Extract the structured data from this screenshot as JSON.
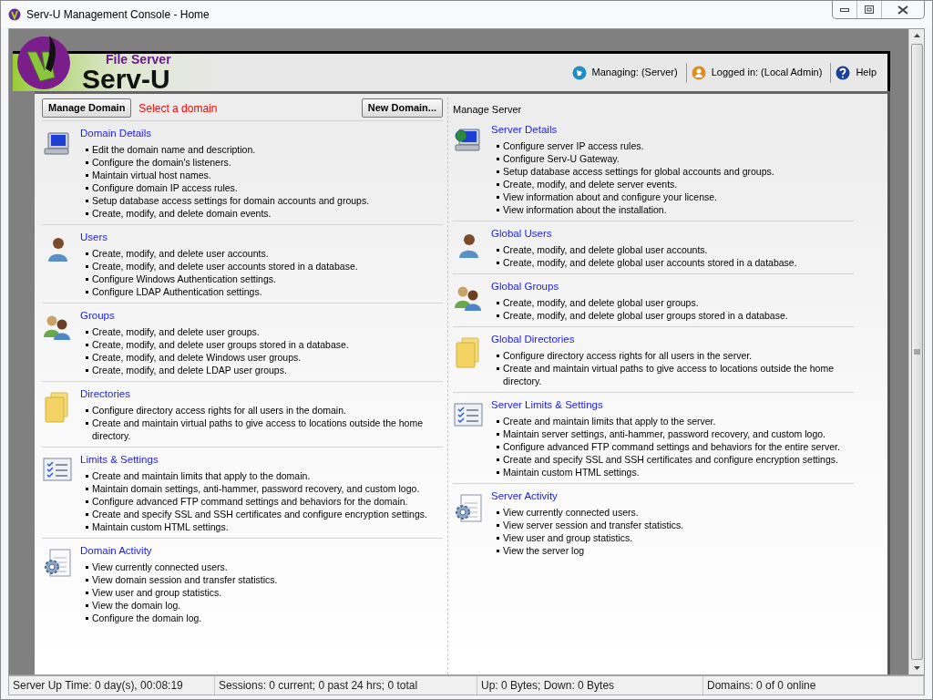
{
  "window": {
    "title": "Serv-U Management Console - Home"
  },
  "logo": {
    "subtitle": "File Server",
    "name": "Serv-U"
  },
  "header_links": [
    {
      "kind": "managing",
      "label": "Managing: (Server)"
    },
    {
      "kind": "user",
      "label": "Logged in: (Local Admin)"
    },
    {
      "kind": "help",
      "label": "Help"
    }
  ],
  "domain_toolbar": {
    "manage_button": "Manage Domain",
    "message": "Select a domain",
    "new_button": "New Domain..."
  },
  "domain_sections": [
    {
      "kind": "monitor",
      "title": "Domain Details",
      "items": [
        "Edit the domain name and description.",
        "Configure the domain's listeners.",
        "Maintain virtual host names.",
        "Configure domain IP access rules.",
        "Setup database access settings for domain accounts and groups.",
        "Create, modify, and delete domain events."
      ]
    },
    {
      "kind": "user",
      "title": "Users",
      "items": [
        "Create, modify, and delete user accounts.",
        "Create, modify, and delete user accounts stored in a database.",
        "Configure Windows Authentication settings.",
        "Configure LDAP Authentication settings."
      ]
    },
    {
      "kind": "group",
      "title": "Groups",
      "items": [
        "Create, modify, and delete user groups.",
        "Create, modify, and delete user groups stored in a database.",
        "Create, modify, and delete Windows user groups.",
        "Create, modify, and delete LDAP user groups."
      ]
    },
    {
      "kind": "folder",
      "title": "Directories",
      "items": [
        "Configure directory access rights for all users in the domain.",
        "Create and maintain virtual paths to give access to locations outside the home directory."
      ]
    },
    {
      "kind": "checklist",
      "title": "Limits & Settings",
      "items": [
        "Create and maintain limits that apply to the domain.",
        "Maintain domain settings, anti-hammer, password recovery, and custom logo.",
        "Configure advanced FTP command settings and behaviors for the domain.",
        "Create and specify SSL and SSH certificates and configure encryption settings.",
        "Maintain custom HTML settings."
      ]
    },
    {
      "kind": "gear",
      "title": "Domain Activity",
      "items": [
        "View currently connected users.",
        "View domain session and transfer statistics.",
        "View user and group statistics.",
        "View the domain log.",
        "Configure the domain log."
      ]
    }
  ],
  "server_heading": "Manage Server",
  "server_sections": [
    {
      "kind": "server",
      "title": "Server Details",
      "items": [
        "Configure server IP access rules.",
        "Configure Serv-U Gateway.",
        "Setup database access settings for global accounts and groups.",
        "Create, modify, and delete server events.",
        "View information about and configure your license.",
        "View information about the installation."
      ]
    },
    {
      "kind": "user",
      "title": "Global Users",
      "items": [
        "Create, modify, and delete global user accounts.",
        "Create, modify, and delete global user accounts stored in a database."
      ]
    },
    {
      "kind": "group",
      "title": "Global Groups",
      "items": [
        "Create, modify, and delete global user groups.",
        "Create, modify, and delete global user groups stored in a database."
      ]
    },
    {
      "kind": "folder",
      "title": "Global Directories",
      "items": [
        "Configure directory access rights for all users in the server.",
        "Create and maintain virtual paths to give access to locations outside the home directory."
      ]
    },
    {
      "kind": "checklist",
      "title": "Server Limits & Settings",
      "items": [
        "Create and maintain limits that apply to the server.",
        "Maintain server settings, anti-hammer, password recovery, and custom logo.",
        "Configure advanced FTP command settings and behaviors for the entire server.",
        "Create and specify SSL and SSH certificates and configure encryption settings.",
        "Maintain custom HTML settings."
      ]
    },
    {
      "kind": "gear",
      "title": "Server Activity",
      "items": [
        "View currently connected users.",
        "View server session and transfer statistics.",
        "View user and group statistics.",
        "View the server log"
      ]
    }
  ],
  "status_bar": [
    "Server Up Time: 0 day(s), 00:08:19",
    "Sessions: 0 current; 0 past 24 hrs; 0 total",
    "Up: 0 Bytes; Down: 0 Bytes",
    "Domains: 0 of 0 online"
  ]
}
